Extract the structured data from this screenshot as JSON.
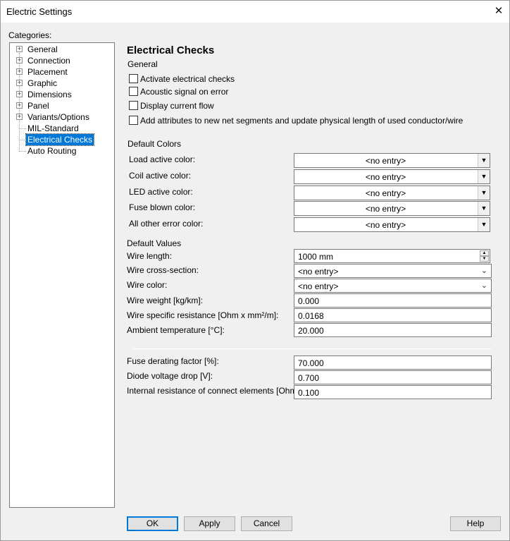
{
  "window": {
    "title": "Electric Settings"
  },
  "categories": {
    "label": "Categories:",
    "items": [
      {
        "label": "General",
        "expandable": true
      },
      {
        "label": "Connection",
        "expandable": true
      },
      {
        "label": "Placement",
        "expandable": true
      },
      {
        "label": "Graphic",
        "expandable": true
      },
      {
        "label": "Dimensions",
        "expandable": true
      },
      {
        "label": "Panel",
        "expandable": true
      },
      {
        "label": "Variants/Options",
        "expandable": true
      },
      {
        "label": "MIL-Standard",
        "expandable": false
      },
      {
        "label": "Electrical Checks",
        "expandable": false,
        "selected": true
      },
      {
        "label": "Auto Routing",
        "expandable": false
      }
    ]
  },
  "page": {
    "heading": "Electrical Checks",
    "general": {
      "label": "General",
      "checks": [
        {
          "label": "Activate electrical checks",
          "checked": false
        },
        {
          "label": "Acoustic signal on error",
          "checked": false
        },
        {
          "label": "Display current flow",
          "checked": false
        },
        {
          "label": "Add attributes to new net segments and update physical length of used conductor/wire",
          "checked": false
        }
      ]
    },
    "default_colors": {
      "label": "Default Colors",
      "rows": [
        {
          "label": "Load active color:",
          "value": "<no entry>"
        },
        {
          "label": "Coil active color:",
          "value": "<no entry>"
        },
        {
          "label": "LED active color:",
          "value": "<no entry>"
        },
        {
          "label": "Fuse blown color:",
          "value": "<no entry>"
        },
        {
          "label": "All other error color:",
          "value": "<no entry>"
        }
      ]
    },
    "default_values": {
      "label": "Default Values",
      "wire_length": {
        "label": "Wire length:",
        "value": "1000 mm"
      },
      "wire_cross_section": {
        "label": "Wire cross-section:",
        "value": "<no entry>"
      },
      "wire_color": {
        "label": "Wire color:",
        "value": "<no entry>"
      },
      "wire_weight": {
        "label": "Wire weight [kg/km]:",
        "value": "0.000"
      },
      "wire_resistance": {
        "label": "Wire specific resistance [Ohm x mm²/m]:",
        "value": "0.0168"
      },
      "ambient_temperature": {
        "label": "Ambient temperature [°C]:",
        "value": "20.000"
      }
    },
    "other": {
      "fuse_derating": {
        "label": "Fuse derating factor [%]:",
        "value": "70.000"
      },
      "diode_voltage": {
        "label": "Diode voltage drop [V]:",
        "value": "0.700"
      },
      "internal_resistance": {
        "label": "Internal resistance of connect elements [Ohm]:",
        "value": "0.100"
      }
    }
  },
  "buttons": {
    "ok": "OK",
    "apply": "Apply",
    "cancel": "Cancel",
    "help": "Help"
  },
  "icons": {
    "close": "close-icon",
    "expand": "plus-icon",
    "dropdown": "chevron-down-icon",
    "spin": "spin-arrows-icon"
  },
  "colors": {
    "selection": "#0078d7",
    "window_bg": "#f0f0f0"
  }
}
